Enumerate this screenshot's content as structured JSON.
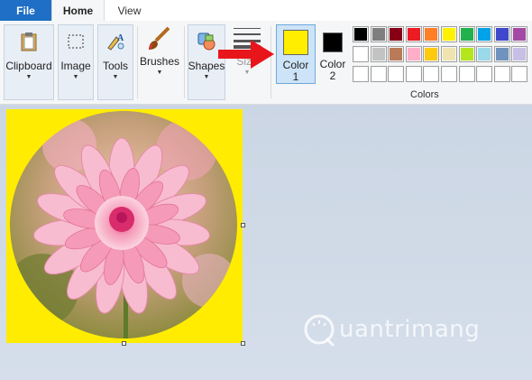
{
  "tabs": {
    "file": "File",
    "home": "Home",
    "view": "View"
  },
  "ribbon": {
    "clipboard": "Clipboard",
    "image": "Image",
    "tools": "Tools",
    "brushes": "Brushes",
    "shapes": "Shapes",
    "size": "Size",
    "color1": "Color",
    "color1_num": "1",
    "color2": "Color",
    "color2_num": "2",
    "colors_group": "Colors"
  },
  "colors": {
    "color1": "#ffee00",
    "color2": "#000000",
    "palette_row1": [
      "#000000",
      "#7f7f7f",
      "#880015",
      "#ed1c24",
      "#ff7f27",
      "#fff200",
      "#22b14c",
      "#00a2e8",
      "#3f48cc",
      "#a349a4"
    ],
    "palette_row2": [
      "#ffffff",
      "#c3c3c3",
      "#b97a57",
      "#ffaec9",
      "#ffc90e",
      "#efe4b0",
      "#b5e61d",
      "#99d9ea",
      "#7092be",
      "#c8bfe7"
    ],
    "palette_row3": [
      "#ffffff",
      "#ffffff",
      "#ffffff",
      "#ffffff",
      "#ffffff",
      "#ffffff",
      "#ffffff",
      "#ffffff",
      "#ffffff",
      "#ffffff"
    ]
  },
  "watermark": "uantrimang"
}
